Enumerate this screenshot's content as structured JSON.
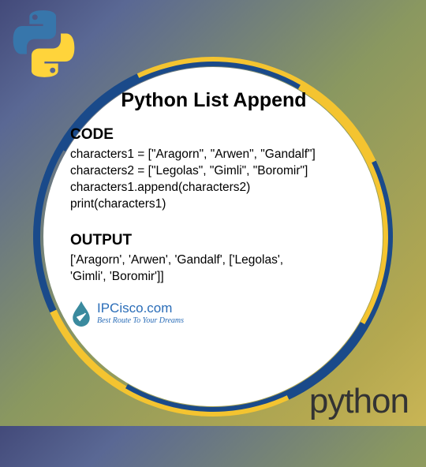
{
  "title": "Python List Append",
  "code": {
    "label": "CODE",
    "lines": [
      "characters1 = [\"Aragorn\", \"Arwen\", \"Gandalf\"]",
      "characters2 = [\"Legolas\", \"Gimli\", \"Boromir\"]",
      " characters1.append(characters2)",
      " print(characters1)"
    ]
  },
  "output": {
    "label": "OUTPUT",
    "lines": [
      "['Aragorn', 'Arwen', 'Gandalf', ['Legolas',",
      "'Gimli', 'Boromir']]"
    ]
  },
  "attribution": {
    "site": "IPCisco.com",
    "tagline": "Best Route To Your Dreams"
  },
  "footer_brand": "python"
}
